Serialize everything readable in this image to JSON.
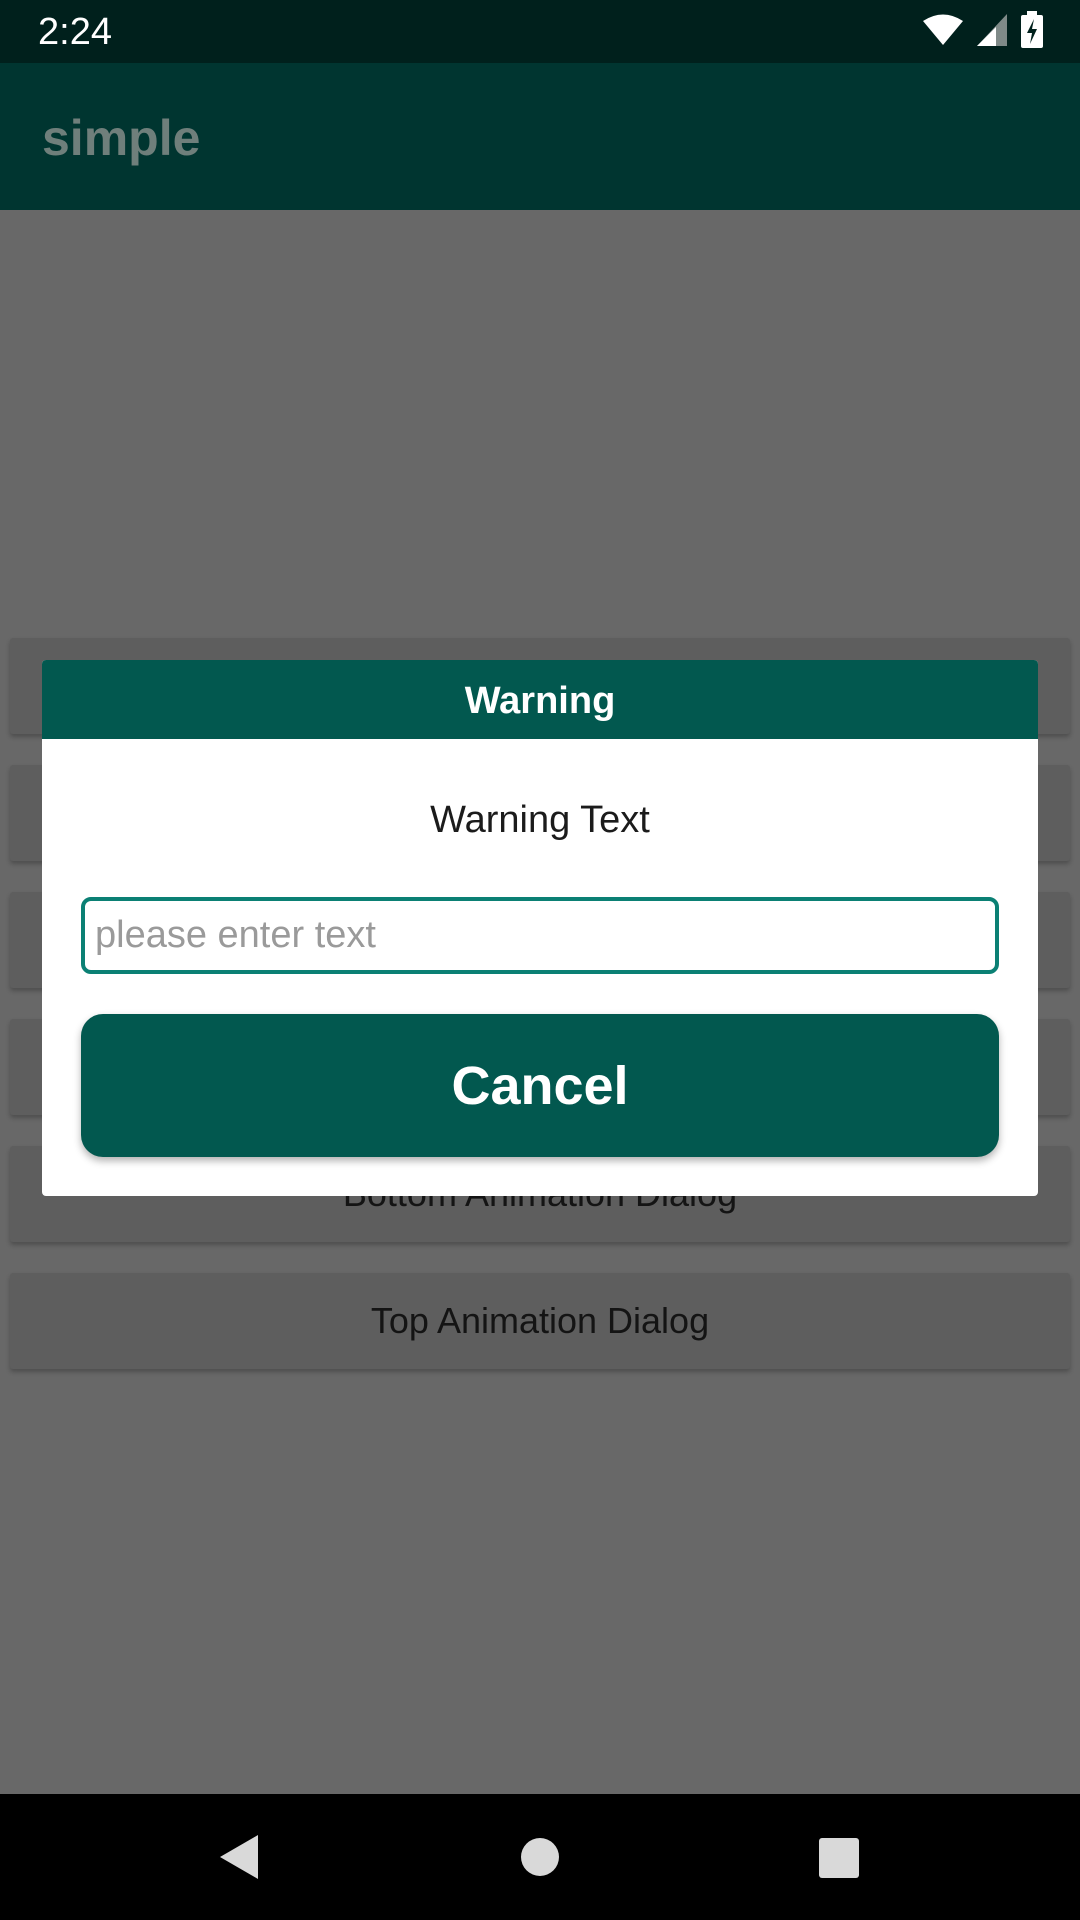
{
  "status_bar": {
    "time": "2:24",
    "icons": [
      "wifi-icon",
      "signal-icon",
      "battery-charging-icon"
    ]
  },
  "app_bar": {
    "title": "simple"
  },
  "background_buttons": [
    {
      "label": ""
    },
    {
      "label": ""
    },
    {
      "label": ""
    },
    {
      "label": ""
    },
    {
      "label": "Bottom Animation Dialog"
    },
    {
      "label": "Top Animation Dialog"
    }
  ],
  "dialog": {
    "title": "Warning",
    "message": "Warning Text",
    "input": {
      "value": "",
      "placeholder": "please enter text"
    },
    "cancel_label": "Cancel"
  },
  "nav_bar": {
    "icons": [
      "back-icon",
      "home-icon",
      "recents-icon"
    ]
  },
  "colors": {
    "status_bar": "#00201c",
    "app_bar": "#003530",
    "accent": "#02584f",
    "input_border": "#0b8074",
    "scrim_background": "#686868"
  }
}
